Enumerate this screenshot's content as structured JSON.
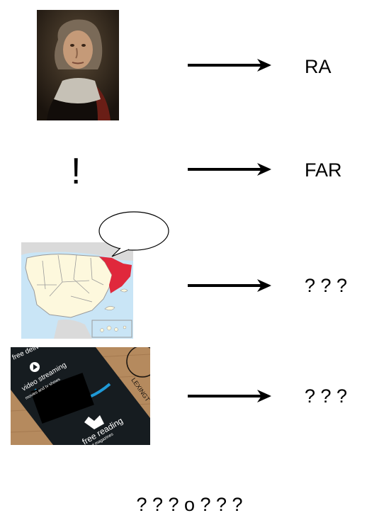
{
  "rows": [
    {
      "image": "pierre-de-fermat-portrait",
      "result": "RA"
    },
    {
      "image": "exclamation-mark",
      "symbol": "!",
      "result": "FAR"
    },
    {
      "image": "map-of-spain-catalonia-highlighted",
      "result": "? ? ?"
    },
    {
      "image": "amazon-prime-box",
      "result": "? ? ?"
    }
  ],
  "amazon_box": {
    "text_1": "video streaming",
    "text_2": "movies and tv shows",
    "text_3": "free reading",
    "text_4": "and magazines",
    "text_5": "free deliv",
    "text_6": "LEXINGT"
  },
  "answer": "? ? ? o ? ? ?",
  "colors": {
    "highlight_region": "#e0283c",
    "sea": "#c9e5f6",
    "land": "#fdf8dd"
  }
}
